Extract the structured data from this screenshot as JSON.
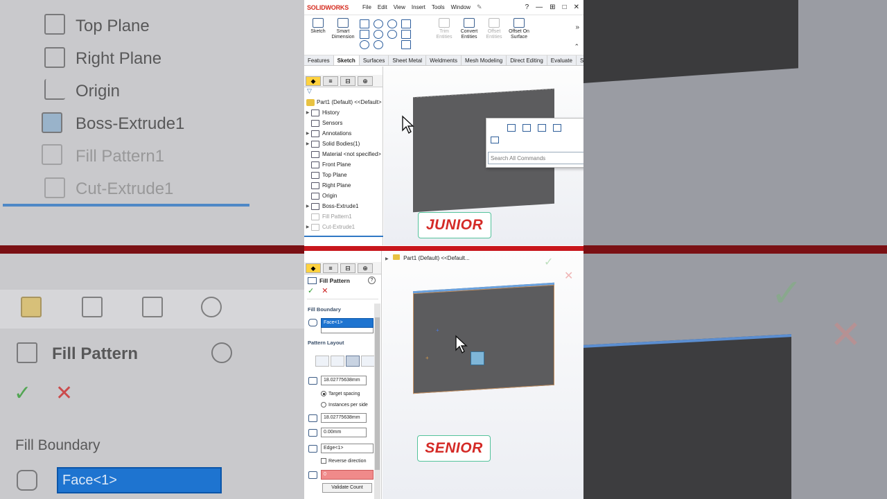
{
  "app": {
    "logo": "SOLIDWORKS",
    "menus": [
      "File",
      "Edit",
      "View",
      "Insert",
      "Tools",
      "Window"
    ]
  },
  "ribbon": {
    "sketch": "Sketch",
    "smart_dimension": "Smart Dimension",
    "trim_entities": "Trim Entities",
    "convert_entities": "Convert Entities",
    "offset_entities": "Offset Entities",
    "offset_on_surface": "Offset On Surface"
  },
  "tabs": [
    "Features",
    "Sketch",
    "Surfaces",
    "Sheet Metal",
    "Weldments",
    "Mesh Modeling",
    "Direct Editing",
    "Evaluate",
    "SO..."
  ],
  "active_tab": "Sketch",
  "tree": {
    "root": "Part1 (Default) <<Default>",
    "items": [
      {
        "label": "History",
        "arrow": true,
        "dim": false
      },
      {
        "label": "Sensors",
        "arrow": false,
        "dim": false
      },
      {
        "label": "Annotations",
        "arrow": true,
        "dim": false
      },
      {
        "label": "Solid Bodies(1)",
        "arrow": true,
        "dim": false
      },
      {
        "label": "Material <not specified>",
        "arrow": false,
        "dim": false
      },
      {
        "label": "Front Plane",
        "arrow": false,
        "dim": false
      },
      {
        "label": "Top Plane",
        "arrow": false,
        "dim": false
      },
      {
        "label": "Right Plane",
        "arrow": false,
        "dim": false
      },
      {
        "label": "Origin",
        "arrow": false,
        "dim": false
      },
      {
        "label": "Boss-Extrude1",
        "arrow": true,
        "dim": false
      },
      {
        "label": "Fill Pattern1",
        "arrow": false,
        "dim": true
      },
      {
        "label": "Cut-Extrude1",
        "arrow": true,
        "dim": true
      }
    ]
  },
  "context_menu": {
    "search_placeholder": "Search All Commands"
  },
  "labels": {
    "junior": "JUNIOR",
    "senior": "SENIOR"
  },
  "property_manager": {
    "title": "Fill Pattern",
    "fill_boundary": "Fill Boundary",
    "face_value": "Face<1>",
    "pattern_layout": "Pattern Layout",
    "spacing_1": "18.02775638mm",
    "target_spacing": "Target spacing",
    "instances_per_side": "Instances per side",
    "spacing_2": "18.02775638mm",
    "angle": "0.00mm",
    "edge": "Edge<1>",
    "reverse_direction": "Reverse direction",
    "count_value": "0",
    "validate_count": "Validate Count"
  },
  "breadcrumb": "Part1 (Default) <<Default...",
  "background": {
    "left_tree": [
      "Top Plane",
      "Right Plane",
      "Origin",
      "Boss-Extrude1",
      "Fill Pattern1",
      "Cut-Extrude1"
    ],
    "left_title": "Fill Pattern",
    "left_section": "Fill Boundary",
    "left_face": "Face<1>"
  }
}
